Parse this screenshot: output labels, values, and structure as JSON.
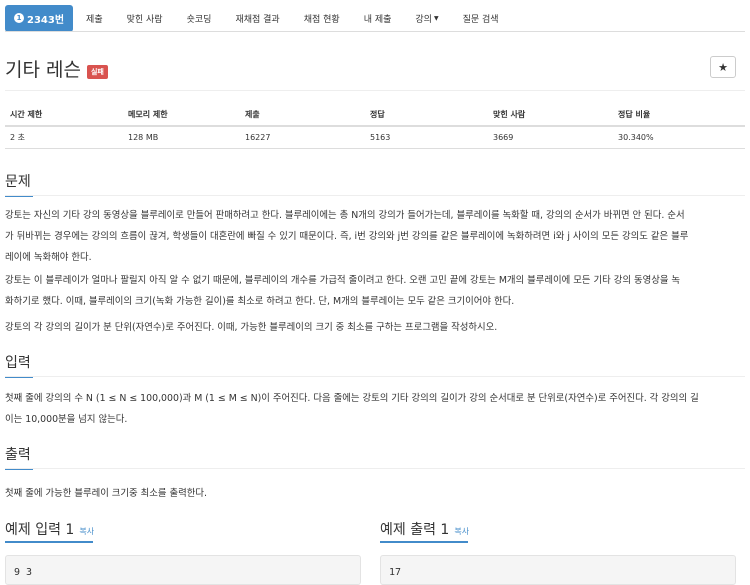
{
  "nav": {
    "active": "2343번",
    "items": [
      "제출",
      "맞힌 사람",
      "숏코딩",
      "재채점 결과",
      "채점 현황",
      "내 제출",
      "강의",
      "질문 검색"
    ]
  },
  "problem": {
    "title": "기타 레슨",
    "badge": "실패",
    "star": "★"
  },
  "stats": {
    "headers": [
      "시간 제한",
      "메모리 제한",
      "제출",
      "정답",
      "맞힌 사람",
      "정답 비율"
    ],
    "values": [
      "2 초",
      "128 MB",
      "16227",
      "5163",
      "3669",
      "30.340%"
    ]
  },
  "sections": {
    "desc_title": "문제",
    "desc_p1_l1": "강토는 자신의 기타 강의 동영상을 블루레이로 만들어 판매하려고 한다. 블루레이에는 총 N개의 강의가 들어가는데, 블루레이를 녹화할 때, 강의의 순서가 바뀌면 안 된다. 순서",
    "desc_p1_l2": "가 뒤바뀌는 경우에는 강의의 흐름이 끊겨, 학생들이 대혼란에 빠질 수 있기 때문이다. 즉, i번 강의와 j번 강의를 같은 블루레이에 녹화하려면 i와 j 사이의 모든 강의도 같은 블루",
    "desc_p1_l3": "레이에 녹화해야 한다.",
    "desc_p2_l1": "강토는 이 블루레이가 얼마나 팔릴지 아직 알 수 없기 때문에, 블루레이의 개수를 가급적 줄이려고 한다. 오랜 고민 끝에 강토는 M개의 블루레이에 모든 기타 강의 동영상을 녹",
    "desc_p2_l2": "화하기로 했다. 이때, 블루레이의 크기(녹화 가능한 길이)를 최소로 하려고 한다. 단, M개의 블루레이는 모두 같은 크기이어야 한다.",
    "desc_p3": "강토의 각 강의의 길이가 분 단위(자연수)로 주어진다. 이때, 가능한 블루레이의 크기 중 최소를 구하는 프로그램을 작성하시오.",
    "input_title": "입력",
    "input_l1": "첫째 줄에 강의의 수 N (1 ≤ N ≤ 100,000)과 M (1 ≤ M ≤ N)이 주어진다. 다음 줄에는 강토의 기타 강의의 길이가 강의 순서대로 분 단위로(자연수)로 주어진다. 각 강의의 길",
    "input_l2": "이는 10,000분을 넘지 않는다.",
    "output_title": "출력",
    "output_text": "첫째 줄에 가능한 블루레이 크기중 최소를 출력한다."
  },
  "samples": {
    "input_title": "예제 입력 1",
    "output_title": "예제 출력 1",
    "copy_label": "복사",
    "input_text": "9 3",
    "output_text": "17"
  }
}
